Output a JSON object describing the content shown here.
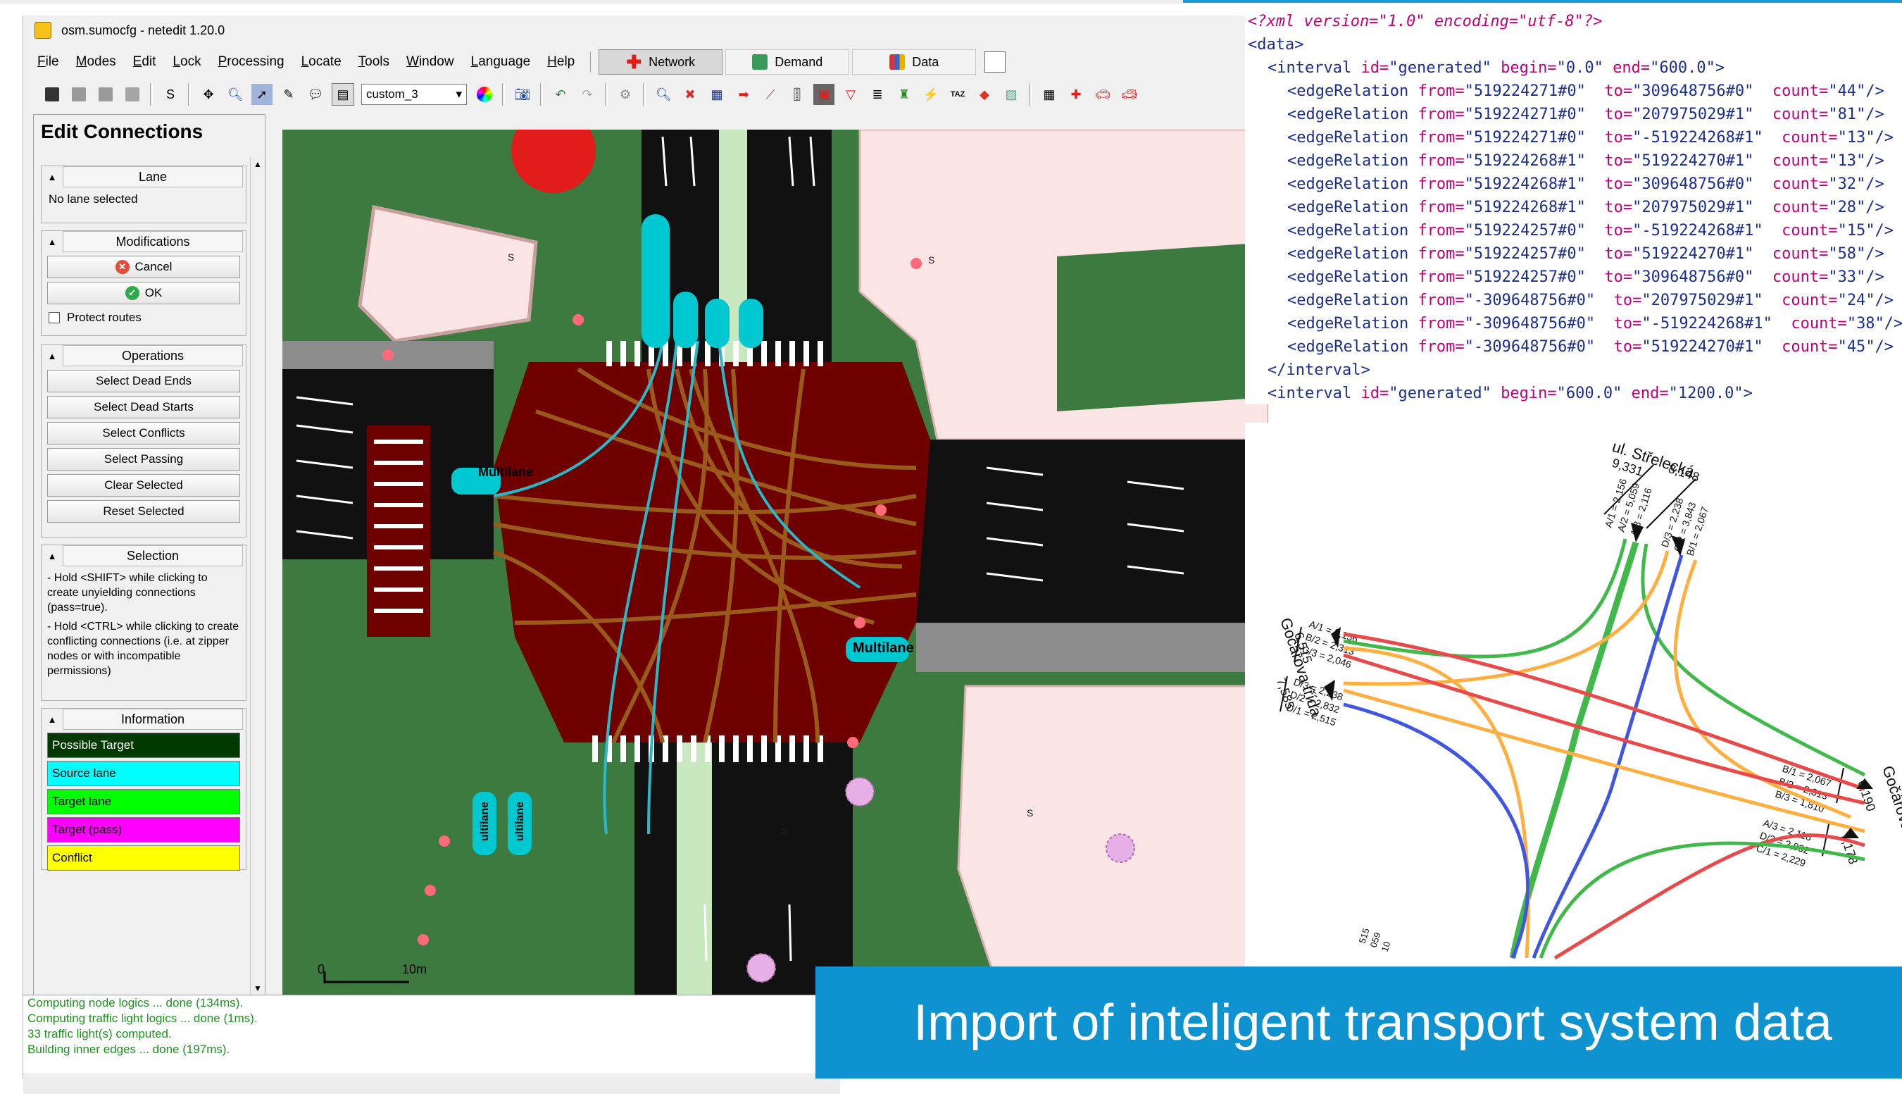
{
  "window": {
    "title": "osm.sumocfg - netedit 1.20.0"
  },
  "menubar": {
    "items": [
      "File",
      "Modes",
      "Edit",
      "Lock",
      "Processing",
      "Locate",
      "Tools",
      "Window",
      "Language",
      "Help"
    ],
    "supermodes": [
      "Network",
      "Demand",
      "Data"
    ]
  },
  "toolbar": {
    "view_scheme": "custom_3",
    "s_label": "S"
  },
  "frame": {
    "title": "Edit Connections",
    "lane": {
      "title": "Lane",
      "text": "No lane selected"
    },
    "modifications": {
      "title": "Modifications",
      "cancel": "Cancel",
      "ok": "OK",
      "protect_routes": "Protect routes"
    },
    "operations": {
      "title": "Operations",
      "buttons": [
        "Select Dead Ends",
        "Select Dead Starts",
        "Select Conflicts",
        "Select Passing",
        "Clear Selected",
        "Reset Selected"
      ]
    },
    "selection": {
      "title": "Selection",
      "hint1": "- Hold <SHIFT> while clicking to create unyielding connections (pass=true).",
      "hint2": "- Hold <CTRL> while clicking to create conflicting connections (i.e. at zipper nodes or with incompatible permissions)"
    },
    "information": {
      "title": "Information",
      "legend": [
        "Possible Target",
        "Source lane",
        "Target lane",
        "Target (pass)",
        "Conflict"
      ]
    },
    "colors": {
      "possible_target": "#003a00",
      "source_lane": "#00ffff",
      "target_lane": "#00ff00",
      "target_pass": "#ff00ff",
      "conflict": "#ffff00"
    }
  },
  "canvas": {
    "scale_zero": "0",
    "scale_label": "10m",
    "labels": {
      "multilane": "Multilane",
      "multilane_partial": "ultilane"
    },
    "sign_s": "S"
  },
  "log": [
    "Computing node logics ... done (134ms).",
    "Computing traffic light logics ... done (1ms).",
    " 33 traffic light(s) computed.",
    "Building inner edges ... done (197ms)."
  ],
  "xml": {
    "declaration": "<?xml version=\"1.0\" encoding=\"utf-8\"?>",
    "root": "<data>",
    "interval1": {
      "id": "generated",
      "begin": "0.0",
      "end": "600.0"
    },
    "relations": [
      {
        "from": "519224271#0",
        "to": "309648756#0",
        "count": "44"
      },
      {
        "from": "519224271#0",
        "to": "207975029#1",
        "count": "81"
      },
      {
        "from": "519224271#0",
        "to": "-519224268#1",
        "count": "13"
      },
      {
        "from": "519224268#1",
        "to": "519224270#1",
        "count": "13"
      },
      {
        "from": "519224268#1",
        "to": "309648756#0",
        "count": "32"
      },
      {
        "from": "519224268#1",
        "to": "207975029#1",
        "count": "28"
      },
      {
        "from": "519224257#0",
        "to": "-519224268#1",
        "count": "15"
      },
      {
        "from": "519224257#0",
        "to": "519224270#1",
        "count": "58"
      },
      {
        "from": "519224257#0",
        "to": "309648756#0",
        "count": "33"
      },
      {
        "from": "-309648756#0",
        "to": "207975029#1",
        "count": "24"
      },
      {
        "from": "-309648756#0",
        "to": "-519224268#1",
        "count": "38"
      },
      {
        "from": "-309648756#0",
        "to": "519224270#1",
        "count": "45"
      }
    ],
    "interval_close": "</interval>",
    "interval2": {
      "id": "generated",
      "begin": "600.0",
      "end": "1200.0"
    }
  },
  "diagram": {
    "street_top": "ul. Střelecká",
    "street_side": "Gočárova třída",
    "top_in_total": "9,331",
    "top_out_total": "8,148",
    "top_in": [
      "A/1 = 2,156",
      "A/2 = 5,059",
      "A/3 = 2,116"
    ],
    "top_out": [
      "D/3 = 2,238",
      "C/2 = 3,843",
      "B/1 = 2,067"
    ],
    "left_in_total": "6,515",
    "left_in": [
      "A/1 = 2,156",
      "B/2 = 2,313",
      "C/3 = 2,046"
    ],
    "left_out_total": "7,585",
    "left_out": [
      "D/3 = 2,238",
      "D/2 = 2,832",
      "D/1 = 2,515"
    ],
    "right_top_total": "6,190",
    "right_top": [
      "B/1 = 2,067",
      "B/2 = 2,313",
      "B/3 = 1,810"
    ],
    "right_bottom_total": "7,178",
    "right_bottom": [
      "A/3 = 2,116",
      "D/2 = 2,832",
      "C/1 = 2,229"
    ],
    "bottom_partial": [
      "515",
      "059",
      "10"
    ]
  },
  "banner": {
    "text": "Import of inteligent transport system data"
  }
}
